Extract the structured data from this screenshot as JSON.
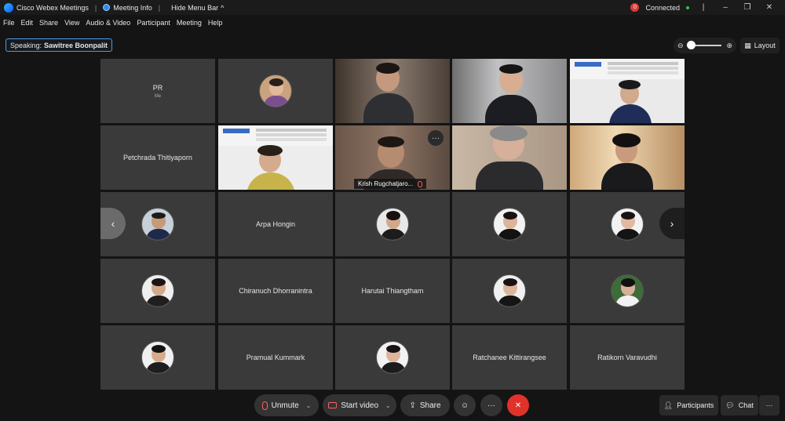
{
  "titlebar": {
    "app_title": "Cisco Webex Meetings",
    "meeting_info": "Meeting Info",
    "hide_menu": "Hide Menu Bar",
    "record_count": "0",
    "connection": "Connected"
  },
  "menu": {
    "items": [
      "File",
      "Edit",
      "Share",
      "View",
      "Audio & Video",
      "Participant",
      "Meeting",
      "Help"
    ]
  },
  "speaking": {
    "label": "Speaking:",
    "name": "Sawitree Boonpalit"
  },
  "layout_label": "Layout",
  "tiles": {
    "self_initials": "PR",
    "self_me": "Me",
    "petchrada": "Petchrada Thitiyaporn",
    "krish": "Krish Rugchatjaro...",
    "arpa": "Arpa Hongin",
    "chiranuch": "Chiranuch Dhorranintra",
    "harutai": "Harutai Thiangtham",
    "pramual": "Pramual Kummark",
    "ratchanee": "Ratchanee Kittirangsee",
    "ratikorn": "Ratikorn Varavudhi"
  },
  "controls": {
    "unmute": "Unmute",
    "start_video": "Start video",
    "share": "Share",
    "participants": "Participants",
    "chat": "Chat"
  },
  "colors": {
    "leave": "#e0322b",
    "speaking_border": "#4a9be8",
    "tile_bg": "#3a3a3a",
    "connected_dot": "#2dc653"
  }
}
